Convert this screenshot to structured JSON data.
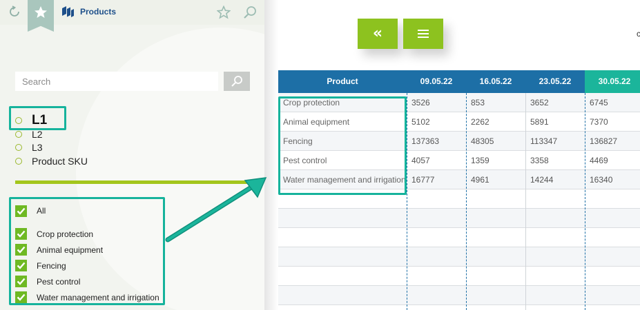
{
  "app": {
    "title": "Products"
  },
  "search": {
    "placeholder": "Search"
  },
  "levels": [
    {
      "label": "L1"
    },
    {
      "label": "L2"
    },
    {
      "label": "L3"
    },
    {
      "label": "Product SKU"
    }
  ],
  "filters": {
    "all_label": "All",
    "items": [
      {
        "label": "Crop protection"
      },
      {
        "label": "Animal equipment"
      },
      {
        "label": "Fencing"
      },
      {
        "label": "Pest control"
      },
      {
        "label": "Water management and irrigation"
      }
    ]
  },
  "toolbar": {
    "collapse_icon": "double-chevron-left",
    "menu_icon": "hamburger",
    "cut_text": "c"
  },
  "table": {
    "headers": [
      "Product",
      "09.05.22",
      "16.05.22",
      "23.05.22",
      "30.05.22"
    ],
    "active_column": 4,
    "rows": [
      {
        "product": "Crop protection",
        "values": [
          "3526",
          "853",
          "3652",
          "6745"
        ]
      },
      {
        "product": "Animal equipment",
        "values": [
          "5102",
          "2262",
          "5891",
          "7370"
        ]
      },
      {
        "product": "Fencing",
        "values": [
          "137363",
          "48305",
          "113347",
          "136827"
        ]
      },
      {
        "product": "Pest control",
        "values": [
          "4057",
          "1359",
          "3358",
          "4469"
        ]
      },
      {
        "product": "Water management and irrigation",
        "values": [
          "16777",
          "4961",
          "14244",
          "16340"
        ]
      }
    ],
    "empty_rows": 6
  },
  "colors": {
    "accent_green": "#8dc21f",
    "header_blue": "#1d6fa6",
    "active_teal": "#1bb59b",
    "highlight": "#16b39c"
  }
}
